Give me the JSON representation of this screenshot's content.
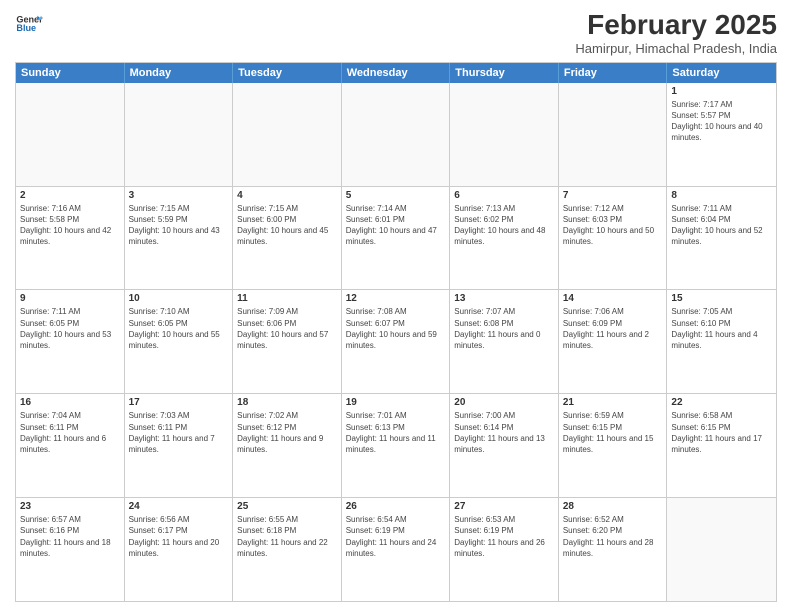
{
  "header": {
    "logo_line1": "General",
    "logo_line2": "Blue",
    "month_year": "February 2025",
    "location": "Hamirpur, Himachal Pradesh, India"
  },
  "weekdays": [
    "Sunday",
    "Monday",
    "Tuesday",
    "Wednesday",
    "Thursday",
    "Friday",
    "Saturday"
  ],
  "rows": [
    [
      {
        "day": "",
        "info": ""
      },
      {
        "day": "",
        "info": ""
      },
      {
        "day": "",
        "info": ""
      },
      {
        "day": "",
        "info": ""
      },
      {
        "day": "",
        "info": ""
      },
      {
        "day": "",
        "info": ""
      },
      {
        "day": "1",
        "info": "Sunrise: 7:17 AM\nSunset: 5:57 PM\nDaylight: 10 hours and 40 minutes."
      }
    ],
    [
      {
        "day": "2",
        "info": "Sunrise: 7:16 AM\nSunset: 5:58 PM\nDaylight: 10 hours and 42 minutes."
      },
      {
        "day": "3",
        "info": "Sunrise: 7:15 AM\nSunset: 5:59 PM\nDaylight: 10 hours and 43 minutes."
      },
      {
        "day": "4",
        "info": "Sunrise: 7:15 AM\nSunset: 6:00 PM\nDaylight: 10 hours and 45 minutes."
      },
      {
        "day": "5",
        "info": "Sunrise: 7:14 AM\nSunset: 6:01 PM\nDaylight: 10 hours and 47 minutes."
      },
      {
        "day": "6",
        "info": "Sunrise: 7:13 AM\nSunset: 6:02 PM\nDaylight: 10 hours and 48 minutes."
      },
      {
        "day": "7",
        "info": "Sunrise: 7:12 AM\nSunset: 6:03 PM\nDaylight: 10 hours and 50 minutes."
      },
      {
        "day": "8",
        "info": "Sunrise: 7:11 AM\nSunset: 6:04 PM\nDaylight: 10 hours and 52 minutes."
      }
    ],
    [
      {
        "day": "9",
        "info": "Sunrise: 7:11 AM\nSunset: 6:05 PM\nDaylight: 10 hours and 53 minutes."
      },
      {
        "day": "10",
        "info": "Sunrise: 7:10 AM\nSunset: 6:05 PM\nDaylight: 10 hours and 55 minutes."
      },
      {
        "day": "11",
        "info": "Sunrise: 7:09 AM\nSunset: 6:06 PM\nDaylight: 10 hours and 57 minutes."
      },
      {
        "day": "12",
        "info": "Sunrise: 7:08 AM\nSunset: 6:07 PM\nDaylight: 10 hours and 59 minutes."
      },
      {
        "day": "13",
        "info": "Sunrise: 7:07 AM\nSunset: 6:08 PM\nDaylight: 11 hours and 0 minutes."
      },
      {
        "day": "14",
        "info": "Sunrise: 7:06 AM\nSunset: 6:09 PM\nDaylight: 11 hours and 2 minutes."
      },
      {
        "day": "15",
        "info": "Sunrise: 7:05 AM\nSunset: 6:10 PM\nDaylight: 11 hours and 4 minutes."
      }
    ],
    [
      {
        "day": "16",
        "info": "Sunrise: 7:04 AM\nSunset: 6:11 PM\nDaylight: 11 hours and 6 minutes."
      },
      {
        "day": "17",
        "info": "Sunrise: 7:03 AM\nSunset: 6:11 PM\nDaylight: 11 hours and 7 minutes."
      },
      {
        "day": "18",
        "info": "Sunrise: 7:02 AM\nSunset: 6:12 PM\nDaylight: 11 hours and 9 minutes."
      },
      {
        "day": "19",
        "info": "Sunrise: 7:01 AM\nSunset: 6:13 PM\nDaylight: 11 hours and 11 minutes."
      },
      {
        "day": "20",
        "info": "Sunrise: 7:00 AM\nSunset: 6:14 PM\nDaylight: 11 hours and 13 minutes."
      },
      {
        "day": "21",
        "info": "Sunrise: 6:59 AM\nSunset: 6:15 PM\nDaylight: 11 hours and 15 minutes."
      },
      {
        "day": "22",
        "info": "Sunrise: 6:58 AM\nSunset: 6:15 PM\nDaylight: 11 hours and 17 minutes."
      }
    ],
    [
      {
        "day": "23",
        "info": "Sunrise: 6:57 AM\nSunset: 6:16 PM\nDaylight: 11 hours and 18 minutes."
      },
      {
        "day": "24",
        "info": "Sunrise: 6:56 AM\nSunset: 6:17 PM\nDaylight: 11 hours and 20 minutes."
      },
      {
        "day": "25",
        "info": "Sunrise: 6:55 AM\nSunset: 6:18 PM\nDaylight: 11 hours and 22 minutes."
      },
      {
        "day": "26",
        "info": "Sunrise: 6:54 AM\nSunset: 6:19 PM\nDaylight: 11 hours and 24 minutes."
      },
      {
        "day": "27",
        "info": "Sunrise: 6:53 AM\nSunset: 6:19 PM\nDaylight: 11 hours and 26 minutes."
      },
      {
        "day": "28",
        "info": "Sunrise: 6:52 AM\nSunset: 6:20 PM\nDaylight: 11 hours and 28 minutes."
      },
      {
        "day": "",
        "info": ""
      }
    ]
  ]
}
